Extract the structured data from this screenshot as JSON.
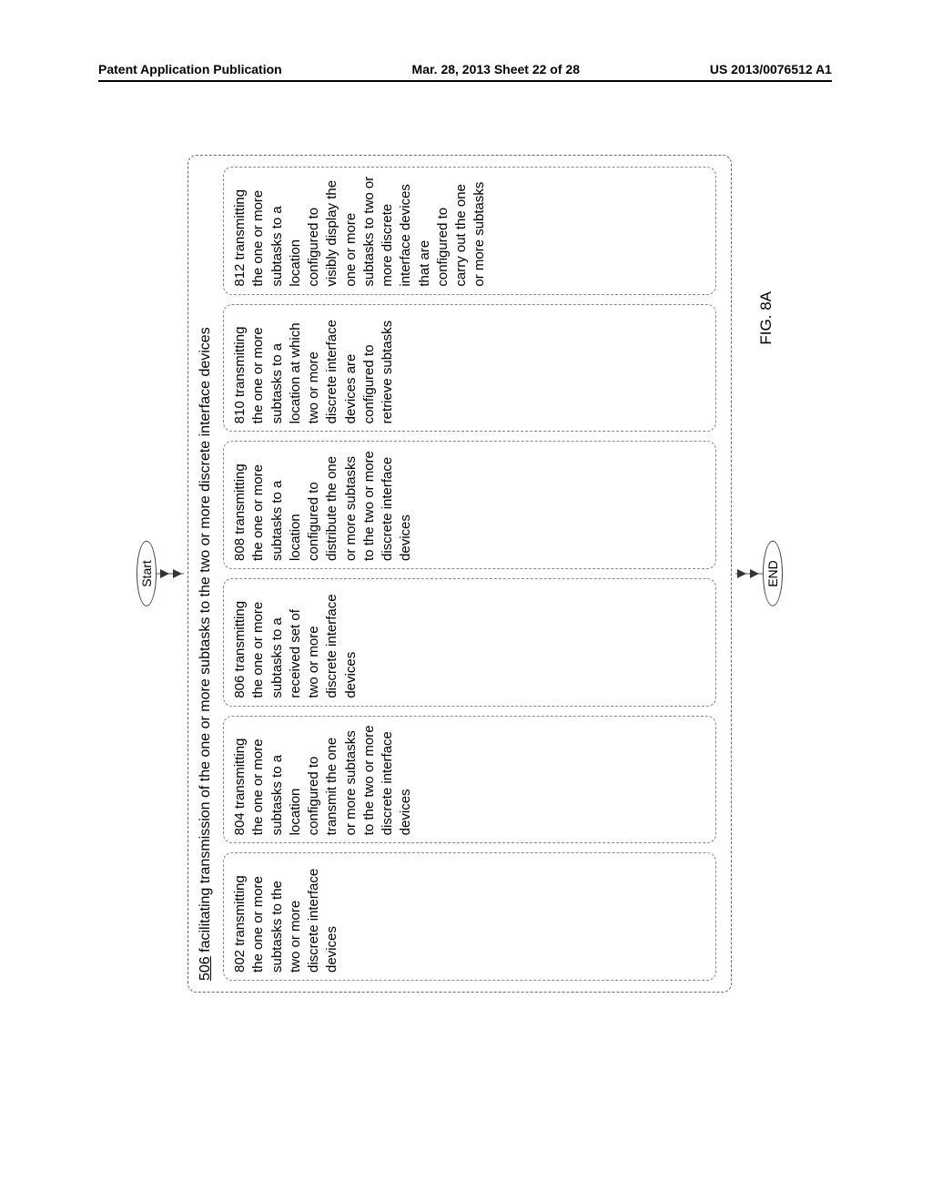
{
  "header": {
    "left": "Patent Application Publication",
    "center": "Mar. 28, 2013  Sheet 22 of 28",
    "right": "US 2013/0076512 A1"
  },
  "flow": {
    "start": "Start",
    "end": "END",
    "outer_number": "506",
    "outer_text": "facilitating transmission of the one or more subtasks to the two or more discrete interface devices",
    "boxes": [
      "802 transmitting the one or more subtasks to the two or more discrete interface devices",
      "804 transmitting the one or more subtasks to a location configured to transmit the one or more subtasks to the two or more discrete interface devices",
      "806 transmitting the one or more subtasks to a received set of two or more discrete interface devices",
      "808 transmitting the one or more subtasks to a location configured to distribute the one or more subtasks to the two or more discrete interface devices",
      "810 transmitting the one or more subtasks to a location at which two or more discrete interface devices are configured to retrieve subtasks",
      "812 transmitting the one or more subtasks to a location configured to visibly display the one or more subtasks to two or more discrete interface devices that are configured to carry out the one or more subtasks"
    ]
  },
  "figure_label": "FIG. 8A"
}
